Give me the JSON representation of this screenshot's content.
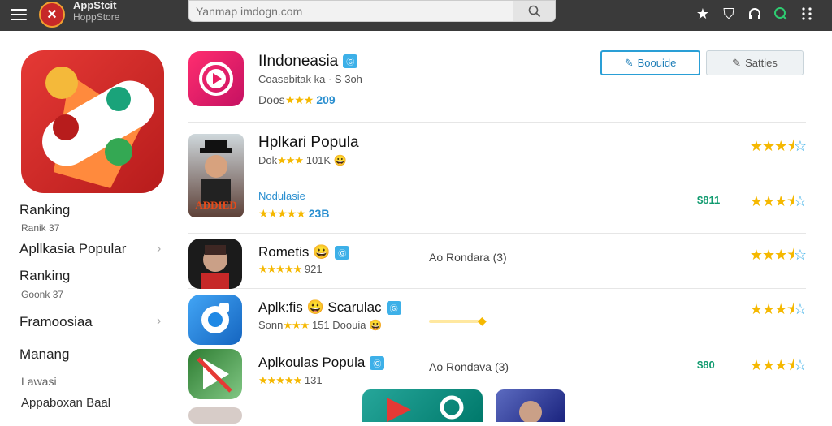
{
  "header": {
    "app_name": "AppStcit",
    "app_subtitle": "HoppStore",
    "search_placeholder": "Yanmap imdogn.com"
  },
  "sidebar": {
    "ranking_1": "Ranking",
    "ranking_1_sub": "Ranik 37",
    "popular": "Apllkasia Popular",
    "ranking_2": "Ranking",
    "ranking_2_sub": "Goonk 37",
    "framoosiaa": "Framoosiaa",
    "manang": "Manang",
    "lawasi": "Lawasi",
    "appabokan": "Appaboxan Baal"
  },
  "apps": [
    {
      "title": "IIndoneasia",
      "badge": "Ⓖ",
      "meta_line1": "Coasebitak ka  ·  S 3oh",
      "rating_prefix": "Doos",
      "rating_count": "209",
      "btn_primary": "Boouide",
      "btn_secondary": "Satties"
    },
    {
      "title": "Hplkari Popula",
      "meta_line1": "Dok",
      "meta_line1_suffix": "101K 😀",
      "sub_title": "Nodulasie",
      "sub_rating_count": "23B",
      "price": "$811"
    },
    {
      "title": "Rometis 😀",
      "badge": "Ⓖ",
      "meta_count": "921",
      "mid_text": "Ao Rondara (3)"
    },
    {
      "title": "Aplk:fis 😀 Scarulac",
      "badge": "Ⓖ",
      "meta_prefix": "Sonn",
      "meta_suffix": "151 Doouia 😀"
    },
    {
      "title": "Aplkoulas Popula",
      "badge": "Ⓖ",
      "meta_count": "131",
      "mid_text": "Ao Rondava (3)",
      "price": "$80"
    }
  ],
  "colors": {
    "topbar": "#3a3a3a",
    "accent_blue": "#2a9fd6",
    "star_gold": "#f5b800",
    "price_green": "#0f9a6e"
  }
}
